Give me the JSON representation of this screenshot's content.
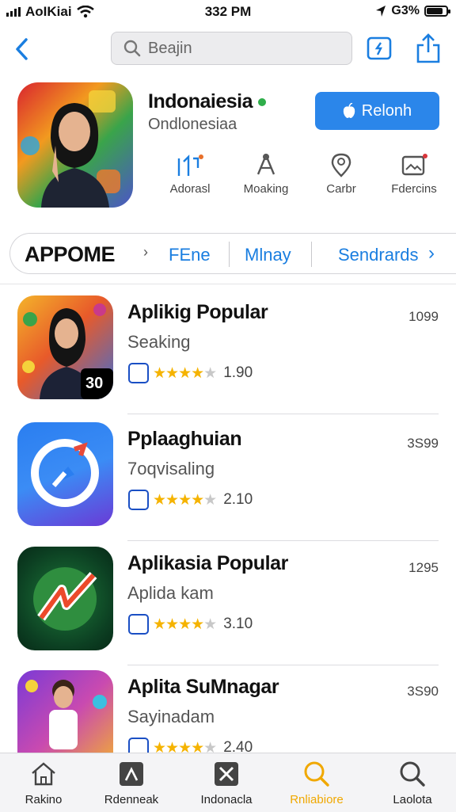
{
  "status": {
    "carrier": "AoIKiai",
    "time": "332 PM",
    "battery": "G3%"
  },
  "search": {
    "placeholder": "Beajin"
  },
  "hero": {
    "title": "Indonaiesia",
    "subtitle": "Ondlonesiaa",
    "get_label": "Relonh",
    "badge_color": "#2fae4a",
    "stats": [
      {
        "icon": "chart-icon",
        "label": "Adorasl"
      },
      {
        "icon": "compass-icon",
        "label": "Moaking"
      },
      {
        "icon": "location-icon",
        "label": "Carbr"
      },
      {
        "icon": "image-icon",
        "label": "Fdercins"
      }
    ]
  },
  "segments": {
    "first": "APPOME",
    "items": [
      "FEne",
      "Mlnay",
      "Sendrards"
    ]
  },
  "apps": [
    {
      "title": "Aplikig Popular",
      "subtitle": "Seaking",
      "size": "1099",
      "rating": 4,
      "rating_text": "1.90",
      "badge": "30"
    },
    {
      "title": "Pplaaghuian",
      "subtitle": "7oqvisaling",
      "size": "3S99",
      "rating": 4,
      "rating_text": "2.10"
    },
    {
      "title": "Aplikasia Popular",
      "subtitle": "Aplida kam",
      "size": "1295",
      "rating": 4,
      "rating_text": "3.10"
    },
    {
      "title": "Aplita SuMnagar",
      "subtitle": "Sayinadam",
      "size": "3S90",
      "rating": 4,
      "rating_text": "2.40"
    }
  ],
  "tabs": [
    {
      "label": "Rakino",
      "icon": "home-icon",
      "active": false
    },
    {
      "label": "Rdenneak",
      "icon": "apps-icon",
      "active": false
    },
    {
      "label": "Indonacla",
      "icon": "games-icon",
      "active": false
    },
    {
      "label": "Rnliabiore",
      "icon": "search-icon",
      "active": true
    },
    {
      "label": "Laolota",
      "icon": "search-icon",
      "active": false
    }
  ],
  "colors": {
    "accent": "#1a7ee0",
    "button": "#2b86ea",
    "star": "#f5b300",
    "active_tab": "#f0a800"
  }
}
